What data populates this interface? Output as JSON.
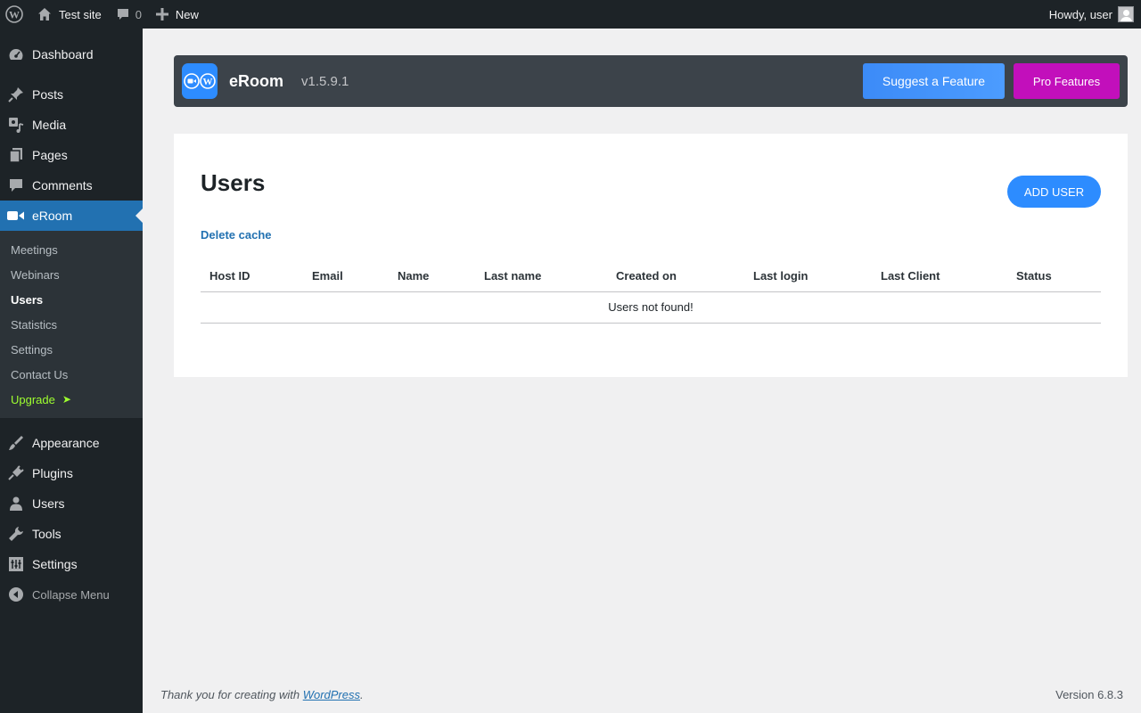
{
  "adminbar": {
    "site_name": "Test site",
    "comments_count": "0",
    "new_label": "New",
    "howdy": "Howdy, user"
  },
  "sidebar": {
    "top_items": [
      {
        "label": "Dashboard",
        "icon": "dashboard-icon"
      },
      {
        "label": "Posts",
        "icon": "pin-icon"
      },
      {
        "label": "Media",
        "icon": "media-icon"
      },
      {
        "label": "Pages",
        "icon": "pages-icon"
      },
      {
        "label": "Comments",
        "icon": "comment-icon"
      },
      {
        "label": "eRoom",
        "icon": "video-camera-icon"
      }
    ],
    "submenu": [
      "Meetings",
      "Webinars",
      "Users",
      "Statistics",
      "Settings",
      "Contact Us"
    ],
    "upgrade_label": "Upgrade",
    "upgrade_arrow": "➤",
    "bottom_items": [
      {
        "label": "Appearance",
        "icon": "brush-icon"
      },
      {
        "label": "Plugins",
        "icon": "plug-icon"
      },
      {
        "label": "Users",
        "icon": "user-icon"
      },
      {
        "label": "Tools",
        "icon": "wrench-icon"
      },
      {
        "label": "Settings",
        "icon": "settings-icon"
      }
    ],
    "collapse_label": "Collapse Menu"
  },
  "header": {
    "brand": "eRoom",
    "version": "v1.5.9.1",
    "suggest_label": "Suggest a Feature",
    "pro_label": "Pro Features"
  },
  "main": {
    "title": "Users",
    "add_user_label": "ADD USER",
    "delete_cache_label": "Delete cache",
    "columns": [
      "Host ID",
      "Email",
      "Name",
      "Last name",
      "Created on",
      "Last login",
      "Last Client",
      "Status"
    ],
    "empty_text": "Users not found!"
  },
  "footer": {
    "thanks_prefix": "Thank you for creating with",
    "wp_link": "WordPress",
    "thanks_suffix": ".",
    "version": "Version 6.8.3"
  },
  "colors": {
    "accent": "#2271b1",
    "eroom_blue": "#2d8cff",
    "pro_magenta": "#c20fbb",
    "upgrade_green": "#9eff2f"
  }
}
